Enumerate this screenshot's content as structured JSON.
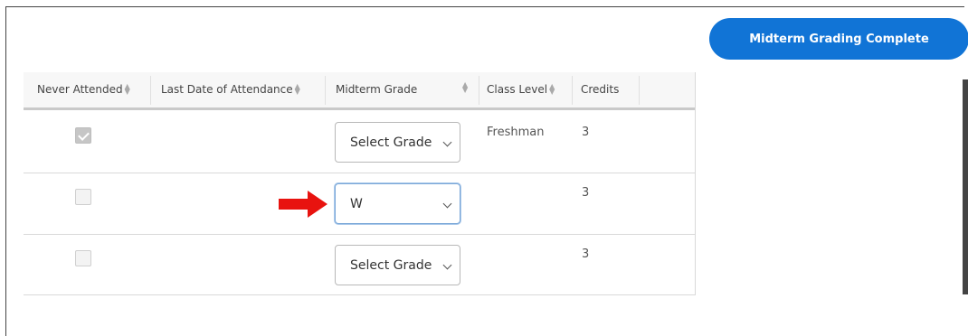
{
  "actions": {
    "midterm_complete_label": "Midterm Grading Complete"
  },
  "table": {
    "columns": [
      {
        "label": "Never Attended",
        "sortable": true
      },
      {
        "label": "Last Date of Attendance",
        "sortable": true
      },
      {
        "label": "Midterm Grade",
        "sortable": true
      },
      {
        "label": "Class Level",
        "sortable": true
      },
      {
        "label": "Credits",
        "sortable": false
      }
    ],
    "rows": [
      {
        "never_attended": true,
        "last_date": "",
        "midterm_grade": "Select Grade",
        "class_level": "Freshman",
        "credits": "3"
      },
      {
        "never_attended": false,
        "last_date": "",
        "midterm_grade": "W",
        "class_level": "",
        "credits": "3"
      },
      {
        "never_attended": false,
        "last_date": "",
        "midterm_grade": "Select Grade",
        "class_level": "",
        "credits": "3"
      }
    ]
  },
  "annotation": {
    "arrow_color": "#e8130f",
    "points_to_row": 1
  },
  "colors": {
    "accent": "#1174d6"
  }
}
